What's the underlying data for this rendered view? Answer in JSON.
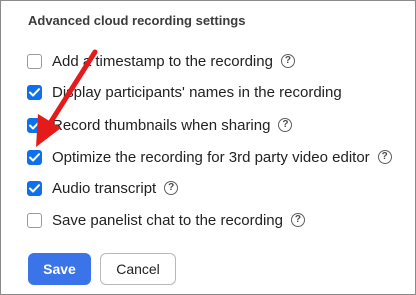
{
  "settings": {
    "title": "Advanced cloud recording settings",
    "options": [
      {
        "label": "Add a timestamp to the recording",
        "checked": false
      },
      {
        "label": "Display participants' names in the recording",
        "checked": true
      },
      {
        "label": "Record thumbnails when sharing",
        "checked": true
      },
      {
        "label": "Optimize the recording for 3rd party video editor",
        "checked": true
      },
      {
        "label": "Audio transcript",
        "checked": true
      },
      {
        "label": "Save panelist chat to the recording",
        "checked": false
      }
    ],
    "help_glyph": "?"
  },
  "buttons": {
    "save_label": "Save",
    "cancel_label": "Cancel"
  },
  "colors": {
    "accent": "#0e71eb",
    "save_button": "#3b74e8",
    "annotation_arrow": "#e51b1b"
  },
  "annotation": {
    "icon": "red-arrow-pointer"
  }
}
